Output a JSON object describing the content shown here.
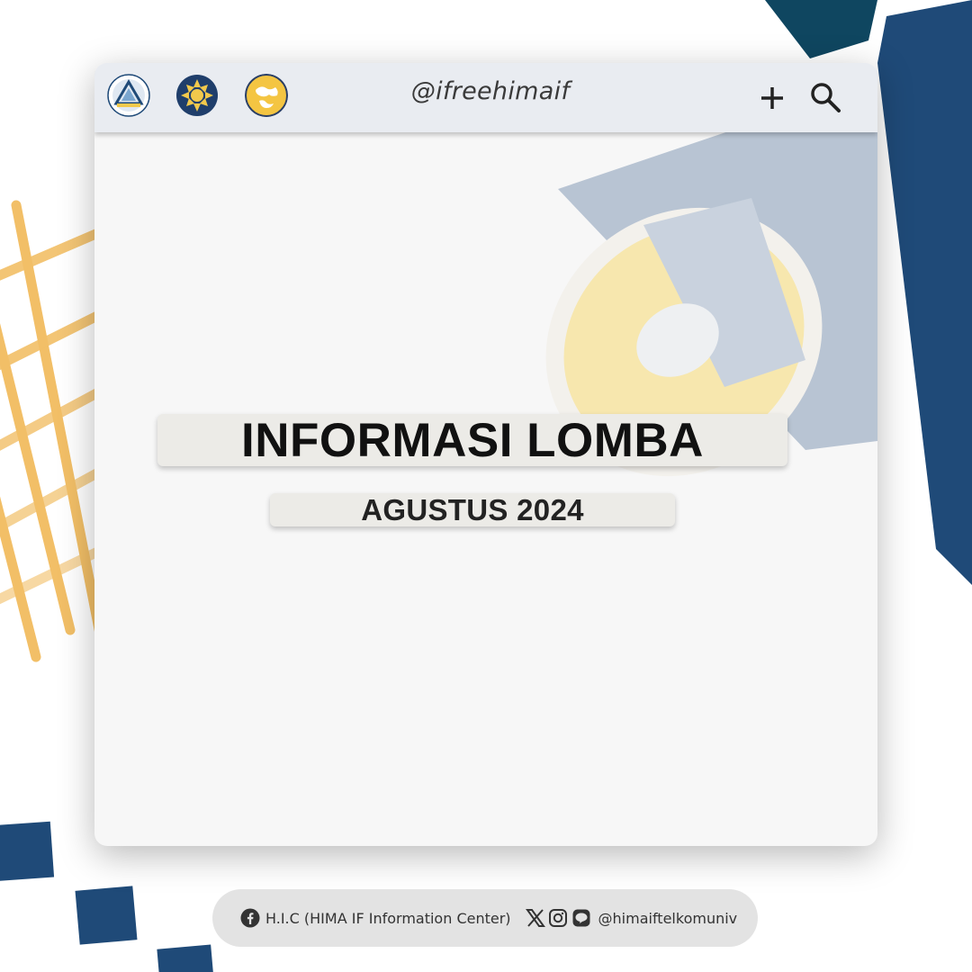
{
  "colors": {
    "navy": "#1f4a78",
    "gold": "#f2bf67",
    "window_bg": "#f7f7f7",
    "topbar_bg": "#e9ecf1",
    "plate_bg": "#ecebe7",
    "footer_bg": "#e3e3e3"
  },
  "topbar": {
    "logos": [
      "logo-emblem-triangle",
      "logo-emblem-sun",
      "logo-emblem-globe"
    ],
    "handle": "@ifreehimaif",
    "add_icon": "plus-icon",
    "search_icon": "search-icon"
  },
  "main": {
    "title": "INFORMASI LOMBA",
    "subtitle": "AGUSTUS 2024",
    "illustration": "megaphone-icon"
  },
  "footer": {
    "facebook_icon": "facebook-icon",
    "org_name": "H.I.C (HIMA IF Information Center)",
    "social_icons": [
      "x-icon",
      "instagram-icon",
      "line-icon"
    ],
    "handle": "@himaiftelkomuniv"
  }
}
